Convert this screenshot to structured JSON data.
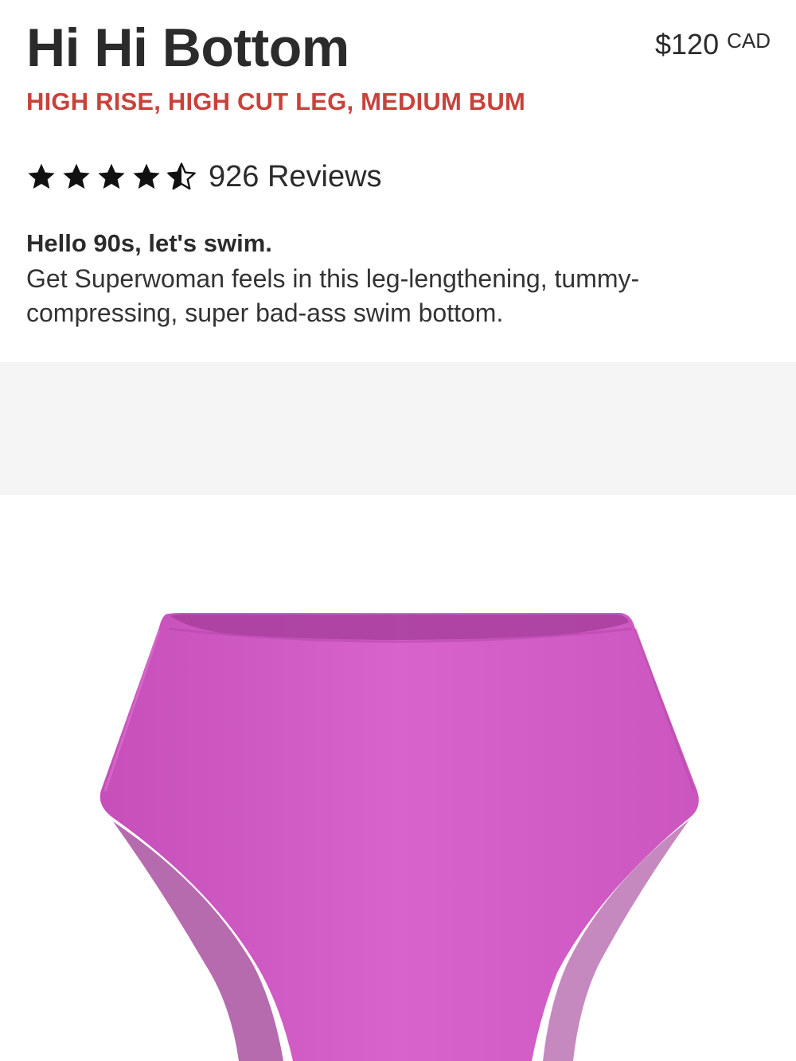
{
  "product": {
    "title": "Hi Hi Bottom",
    "price_amount": "$120",
    "price_currency": "CAD",
    "subtitle": "HIGH RISE, HIGH CUT LEG, MEDIUM BUM",
    "rating": {
      "value": 4.5,
      "max": 5,
      "reviews_label": "926 Reviews"
    },
    "tagline": "Hello 90s, let's swim.",
    "description": "Get Superwoman feels in this leg-lengthening, tummy-compressing, super bad-ass swim bottom.",
    "image": {
      "icon": "swim-bottom-product-image",
      "color": "#d45fc8"
    }
  },
  "colors": {
    "subtitle": "#c8423b",
    "text": "#2b2b2b",
    "band": "#f5f5f5"
  }
}
